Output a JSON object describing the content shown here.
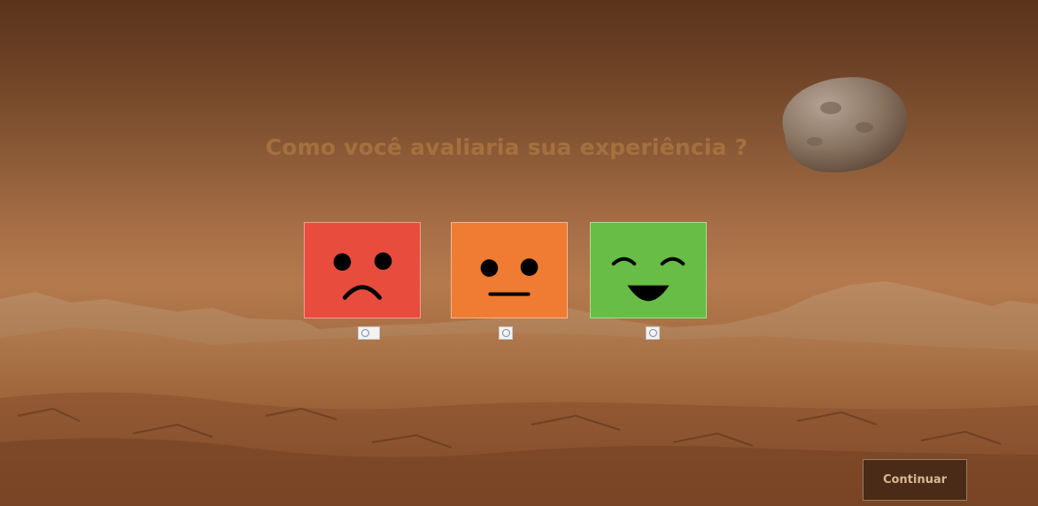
{
  "survey": {
    "question": "Como você avaliaria sua experiência ?",
    "options": [
      {
        "icon": "sad-face-icon",
        "color": "#e84c3d"
      },
      {
        "icon": "neutral-face-icon",
        "color": "#ef7c32"
      },
      {
        "icon": "happy-face-icon",
        "color": "#67bd45"
      }
    ]
  },
  "footer": {
    "continue_label": "Continuar"
  },
  "theme": {
    "background": "#a87048",
    "headline_color": "#a4703f",
    "button_background": "#4a2b17",
    "button_text": "#d9b896"
  }
}
